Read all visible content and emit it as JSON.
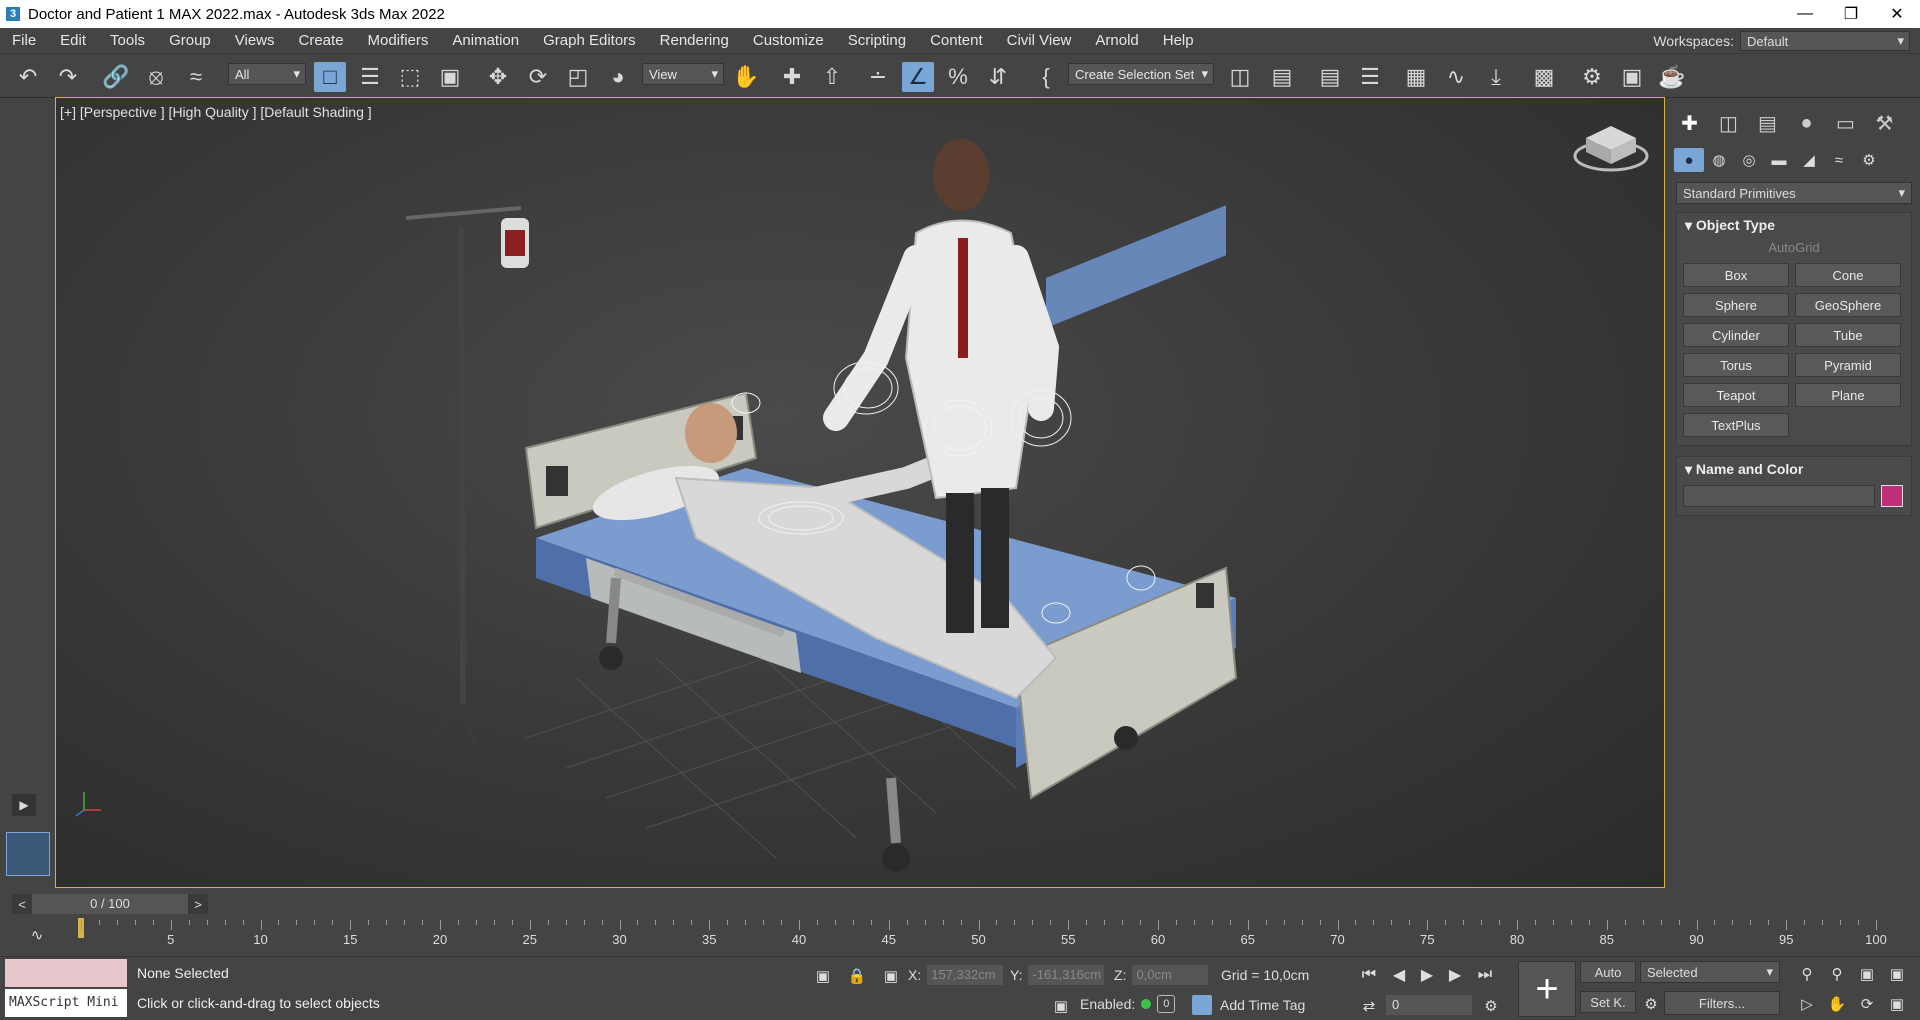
{
  "window": {
    "title": "Doctor and Patient 1 MAX 2022.max - Autodesk 3ds Max 2022",
    "app_icon": "3"
  },
  "menu": [
    "File",
    "Edit",
    "Tools",
    "Group",
    "Views",
    "Create",
    "Modifiers",
    "Animation",
    "Graph Editors",
    "Rendering",
    "Customize",
    "Scripting",
    "Content",
    "Civil View",
    "Arnold",
    "Help"
  ],
  "workspace": {
    "label": "Workspaces:",
    "value": "Default"
  },
  "toolbar": {
    "filter": "All",
    "refcoord": "View",
    "selection_set": "Create Selection Set"
  },
  "viewport": {
    "label": "[+] [Perspective ] [High Quality ] [Default Shading ]"
  },
  "command_panel": {
    "category": "Standard Primitives",
    "object_type": {
      "header": "Object Type",
      "autogrid": "AutoGrid",
      "buttons": [
        "Box",
        "Cone",
        "Sphere",
        "GeoSphere",
        "Cylinder",
        "Tube",
        "Torus",
        "Pyramid",
        "Teapot",
        "Plane",
        "TextPlus"
      ]
    },
    "name_color": {
      "header": "Name and Color",
      "color": "#c0307a"
    }
  },
  "timeline": {
    "slider": "0 / 100",
    "ticks": [
      "5",
      "10",
      "15",
      "20",
      "25",
      "30",
      "35",
      "40",
      "45",
      "50",
      "55",
      "60",
      "65",
      "70",
      "75",
      "80",
      "85",
      "90",
      "95",
      "100"
    ]
  },
  "status": {
    "maxscript": "MAXScript Mini",
    "selection": "None Selected",
    "hint": "Click or click-and-drag to select objects",
    "x_label": "X:",
    "x": "157,332cm",
    "y_label": "Y:",
    "y": "-161,316cm",
    "z_label": "Z:",
    "z": "0,0cm",
    "grid": "Grid = 10,0cm",
    "enabled": "Enabled:",
    "zero": "0",
    "add_time_tag": "Add Time Tag",
    "frame": "0",
    "auto": "Auto",
    "set_key": "Set K.",
    "selected": "Selected",
    "filters": "Filters..."
  }
}
